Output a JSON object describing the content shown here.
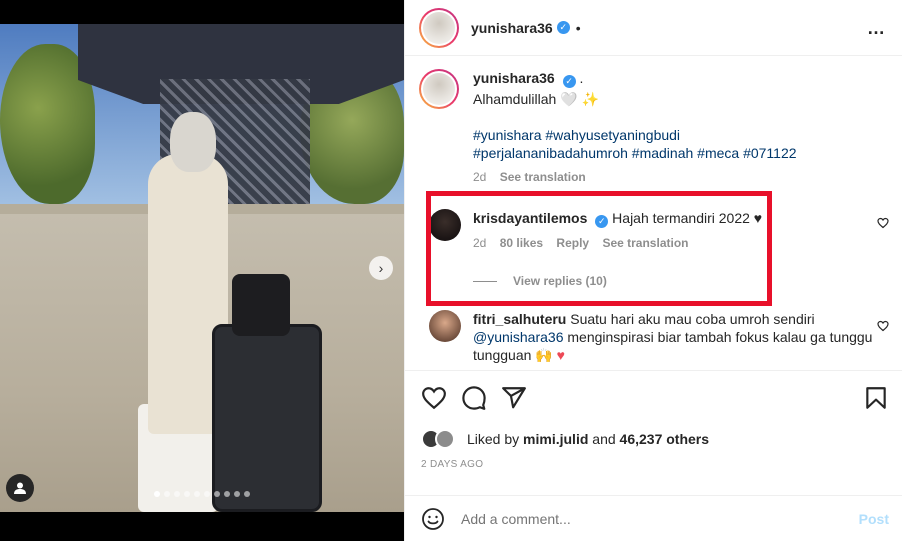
{
  "post": {
    "author": "yunishara36",
    "header_separator": "•",
    "more_icon": "…"
  },
  "caption": {
    "author": "yunishara36",
    "author_suffix": ".",
    "text": "Alhamdulillah",
    "emoji": "🤍 ✨",
    "hashtags_line1": "#yunishara #wahyusetyaningbudi",
    "hashtags_line2": "#perjalananibadahumroh #madinah #meca #071122",
    "time": "2d",
    "see_translation": "See translation"
  },
  "comments": [
    {
      "author": "krisdayantilemos",
      "text": "Hajah termandiri 2022 ♥",
      "time": "2d",
      "likes": "80 likes",
      "reply": "Reply",
      "see_translation": "See translation",
      "view_replies": "View replies (10)"
    },
    {
      "author": "fitri_salhuteru",
      "text_before": "Suatu hari aku mau coba umroh sendiri",
      "mention": "@yunishara36",
      "text_after": " menginspirasi biar tambah fokus kalau ga tunggu tungguan",
      "emoji_hands": "🙌",
      "emoji_heart": "♥"
    }
  ],
  "likes": {
    "prefix": "Liked by",
    "user": "mimi.julid",
    "conjunction": "and",
    "count": "46,237 others"
  },
  "date": "2 DAYS AGO",
  "add_comment": {
    "placeholder": "Add a comment...",
    "post_label": "Post"
  },
  "carousel": {
    "next_arrow": "›",
    "total_slides": 10,
    "active_slide": 1
  },
  "colors": {
    "verified": "#3897f0",
    "link": "#00376b",
    "highlight_box": "#e8102a",
    "post_disabled": "#b2dffc"
  }
}
